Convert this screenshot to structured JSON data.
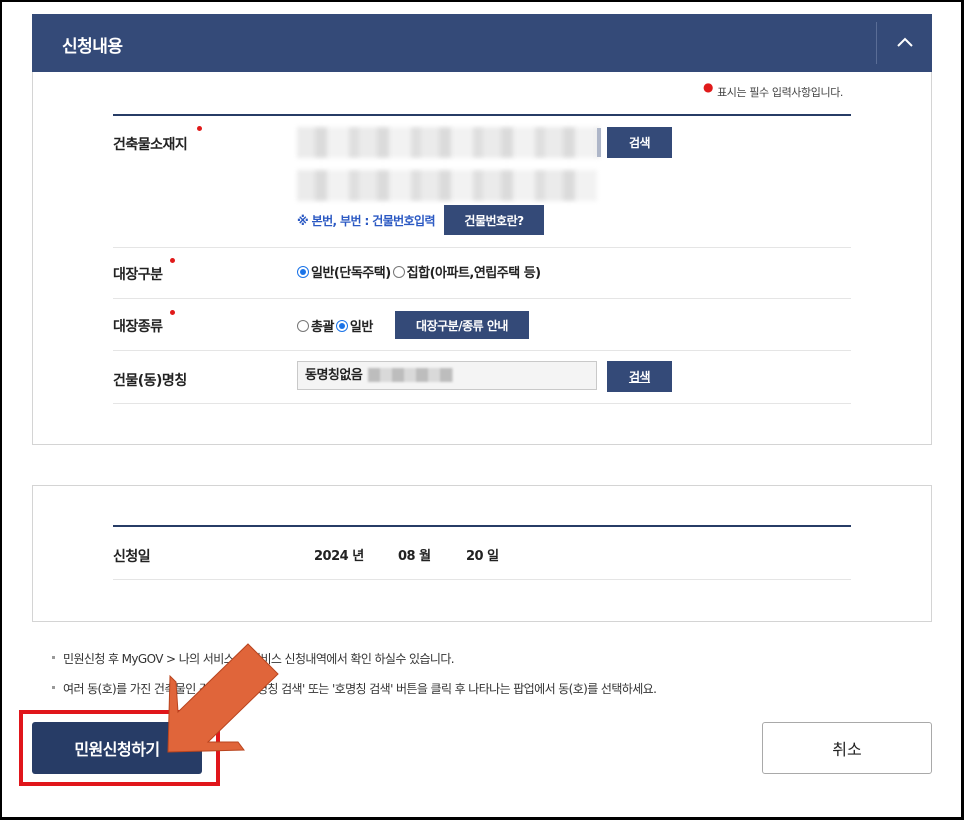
{
  "panel": {
    "title": "신청내용"
  },
  "required_note": "표시는 필수 입력사항입니다.",
  "address": {
    "label": "건축물소재지",
    "search_button": "검색",
    "hint": "※ 본번, 부번 : 건물번호입력",
    "building_number_button": "건물번호란?"
  },
  "ledger_division": {
    "label": "대장구분",
    "options": [
      "일반(단독주택)",
      "집합(아파트,연립주택 등)"
    ],
    "selected": "일반(단독주택)"
  },
  "ledger_type": {
    "label": "대장종류",
    "options": [
      "총괄",
      "일반"
    ],
    "selected": "일반",
    "guide_button": "대장구분/종류 안내"
  },
  "building_name": {
    "label": "건물(동)명칭",
    "value": "동명칭없음",
    "search_button": "검색"
  },
  "application_date": {
    "label": "신청일",
    "year": "2024",
    "year_unit": "년",
    "month": "08",
    "month_unit": "월",
    "day": "20",
    "day_unit": "일"
  },
  "notes": [
    "민원신청 후 MyGOV > 나의 서비스 > 서비스 신청내역에서 확인 하실수 있습니다.",
    "여러 동(호)를 가진 건축물인 경우에는 '동명칭 검색' 또는 '호명칭 검색' 버튼을 클릭 후 나타나는 팝업에서 동(호)를 선택하세요."
  ],
  "actions": {
    "submit": "민원신청하기",
    "cancel": "취소"
  },
  "colors": {
    "navy": "#344a78",
    "highlight": "#e0161b",
    "arrow": "#e0653a"
  }
}
